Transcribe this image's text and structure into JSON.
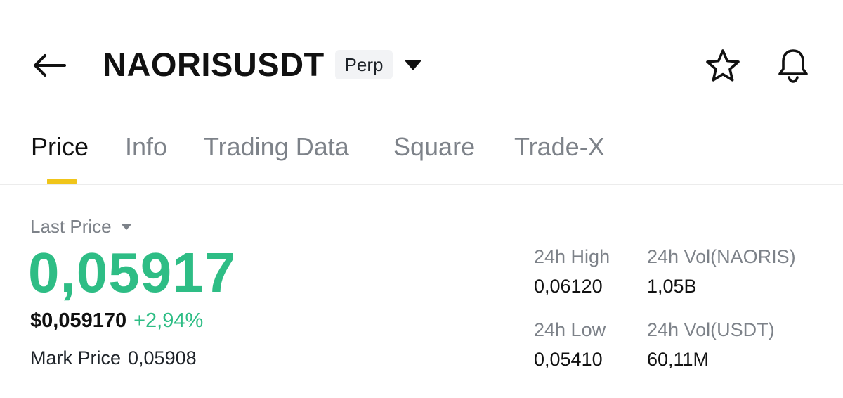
{
  "header": {
    "symbol": "NAORISUSDT",
    "badge": "Perp",
    "icons": {
      "back": "arrow-left-icon",
      "dropdown": "caret-down-icon",
      "favorite": "star-outline-icon",
      "alert": "bell-icon"
    }
  },
  "tabs": [
    {
      "label": "Price",
      "active": true
    },
    {
      "label": "Info",
      "active": false
    },
    {
      "label": "Trading Data",
      "active": false
    },
    {
      "label": "Square",
      "active": false
    },
    {
      "label": "Trade-X",
      "active": false
    }
  ],
  "price": {
    "label": "Last Price",
    "value": "0,05917",
    "usd_value": "$0,059170",
    "change": "+2,94%",
    "mark_label": "Mark Price",
    "mark_value": "0,05908"
  },
  "stats": {
    "high": {
      "label": "24h High",
      "value": "0,06120"
    },
    "vol_base": {
      "label": "24h Vol(NAORIS)",
      "value": "1,05B"
    },
    "low": {
      "label": "24h Low",
      "value": "0,05410"
    },
    "vol_quote": {
      "label": "24h Vol(USDT)",
      "value": "60,11M"
    }
  },
  "colors": {
    "up": "#2ebd85",
    "accent": "#f0c51a",
    "muted": "#7d8289",
    "text": "#111111"
  }
}
